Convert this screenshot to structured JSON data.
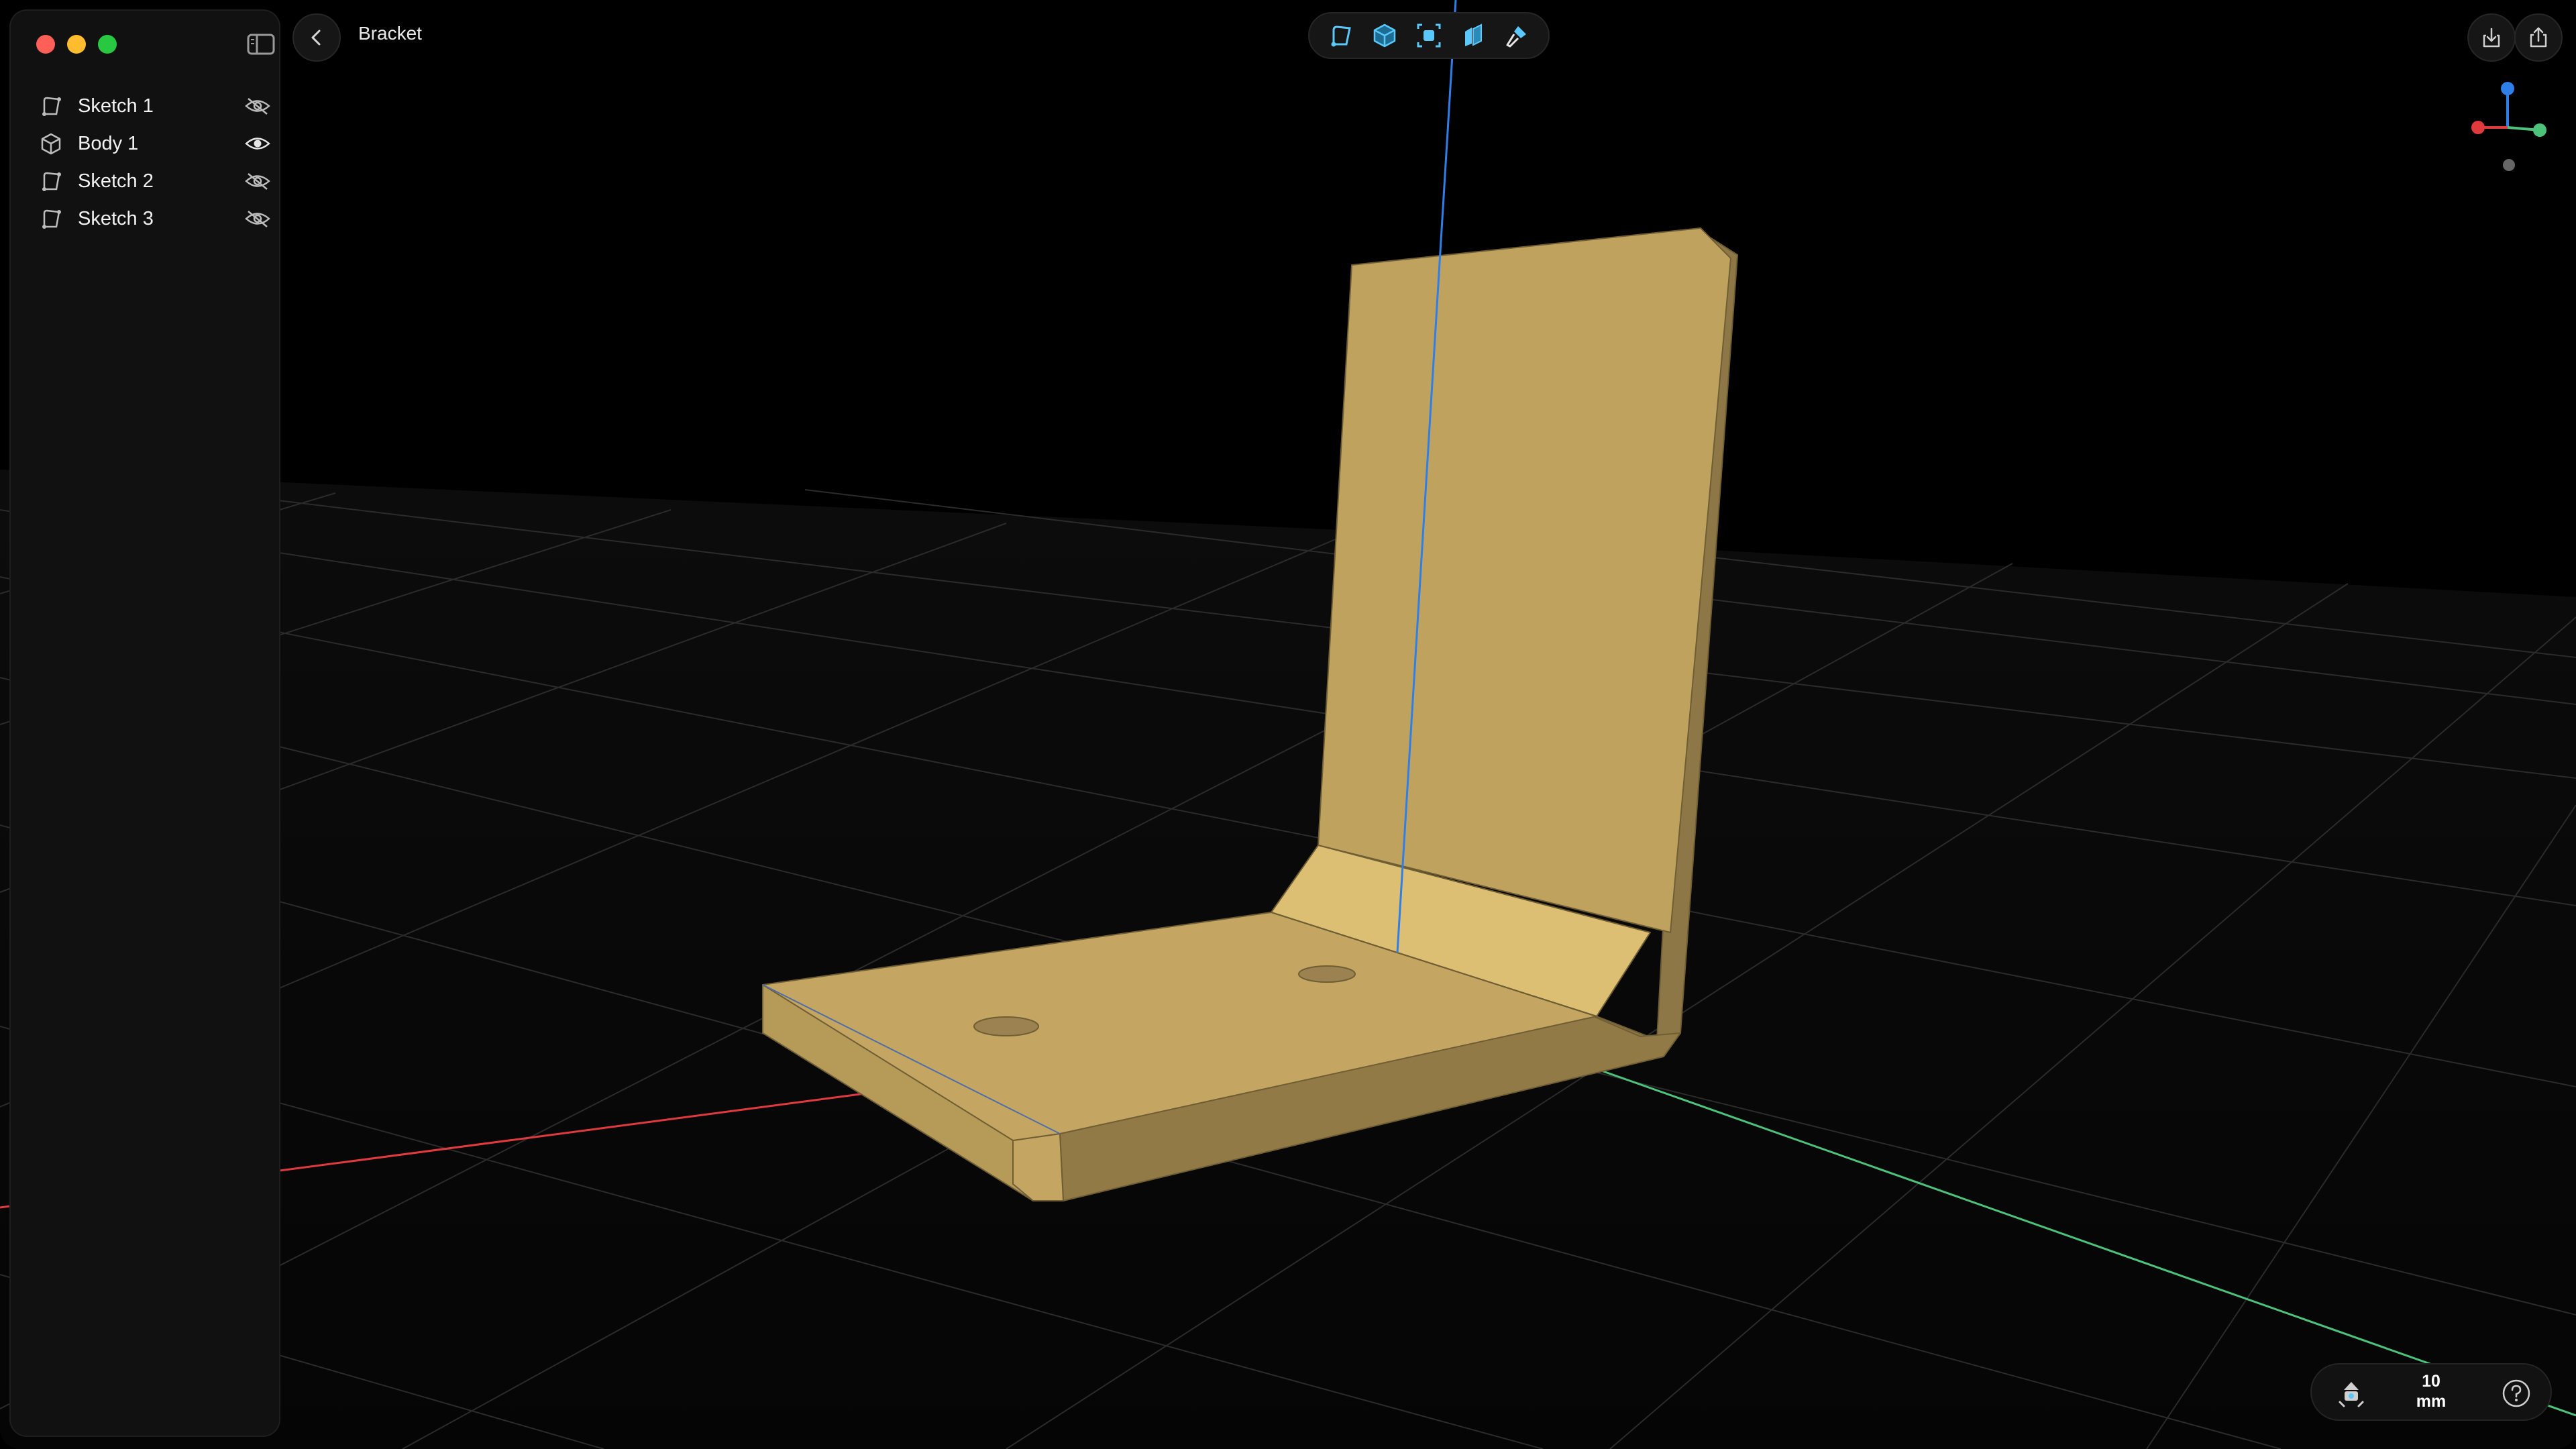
{
  "document": {
    "title": "Bracket"
  },
  "sidebar": {
    "items": [
      {
        "label": "Sketch 1",
        "icon": "sketch-icon",
        "visibility": "hidden"
      },
      {
        "label": "Body 1",
        "icon": "body-cube-icon",
        "visibility": "visible"
      },
      {
        "label": "Sketch 2",
        "icon": "sketch-icon",
        "visibility": "hidden"
      },
      {
        "label": "Sketch 3",
        "icon": "sketch-icon",
        "visibility": "hidden"
      }
    ]
  },
  "toolbar": {
    "tools": [
      "sketch-tool-icon",
      "body-tool-icon",
      "select-tool-icon",
      "extrude-tool-icon",
      "paint-tool-icon"
    ]
  },
  "scale": {
    "value": "10",
    "unit": "mm"
  },
  "colors": {
    "model": "#c8a761",
    "axis_x": "#e0393e",
    "axis_y": "#4cc27a",
    "axis_z": "#2f7fe8",
    "accent": "#5ac8fa"
  }
}
